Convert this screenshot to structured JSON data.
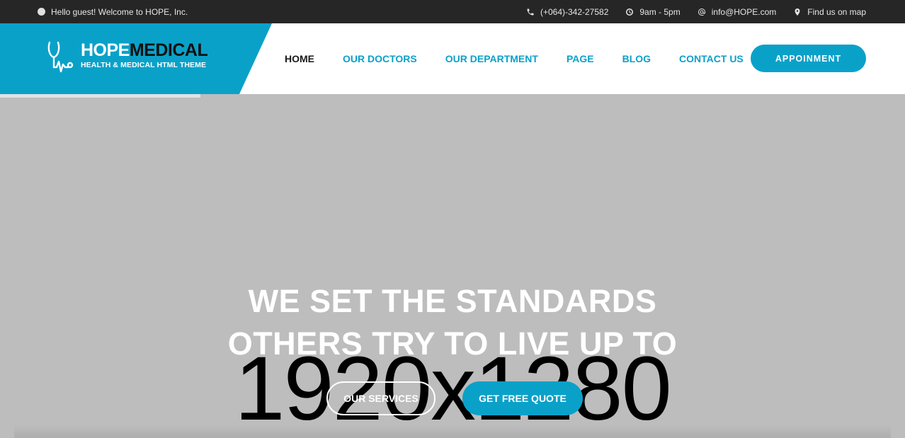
{
  "topbar": {
    "welcome": "Hello guest! Welcome to HOPE, Inc.",
    "phone": "(+064)-342-27582",
    "hours": "9am - 5pm",
    "email": "info@HOPE.com",
    "map": "Find us on map"
  },
  "brand": {
    "name_part1": "HOPE",
    "name_part2": "MEDICAL",
    "tagline": "HEALTH & MEDICAL HTML THEME",
    "colors": {
      "accent": "#0aa1c9",
      "dark": "#262626"
    }
  },
  "nav": {
    "items": [
      {
        "label": "HOME",
        "active": true
      },
      {
        "label": "OUR DOCTORS"
      },
      {
        "label": "OUR DEPARTMENT"
      },
      {
        "label": "PAGE"
      },
      {
        "label": "BLOG"
      },
      {
        "label": "CONTACT US"
      }
    ],
    "appointment": "APPOINMENT"
  },
  "hero": {
    "line1": "WE SET THE STANDARDS",
    "line2": "OTHERS TRY TO LIVE UP TO",
    "placeholder": "1920x1280",
    "btn_services": "OUR SERVICES",
    "btn_quote": "GET FREE QUOTE"
  }
}
